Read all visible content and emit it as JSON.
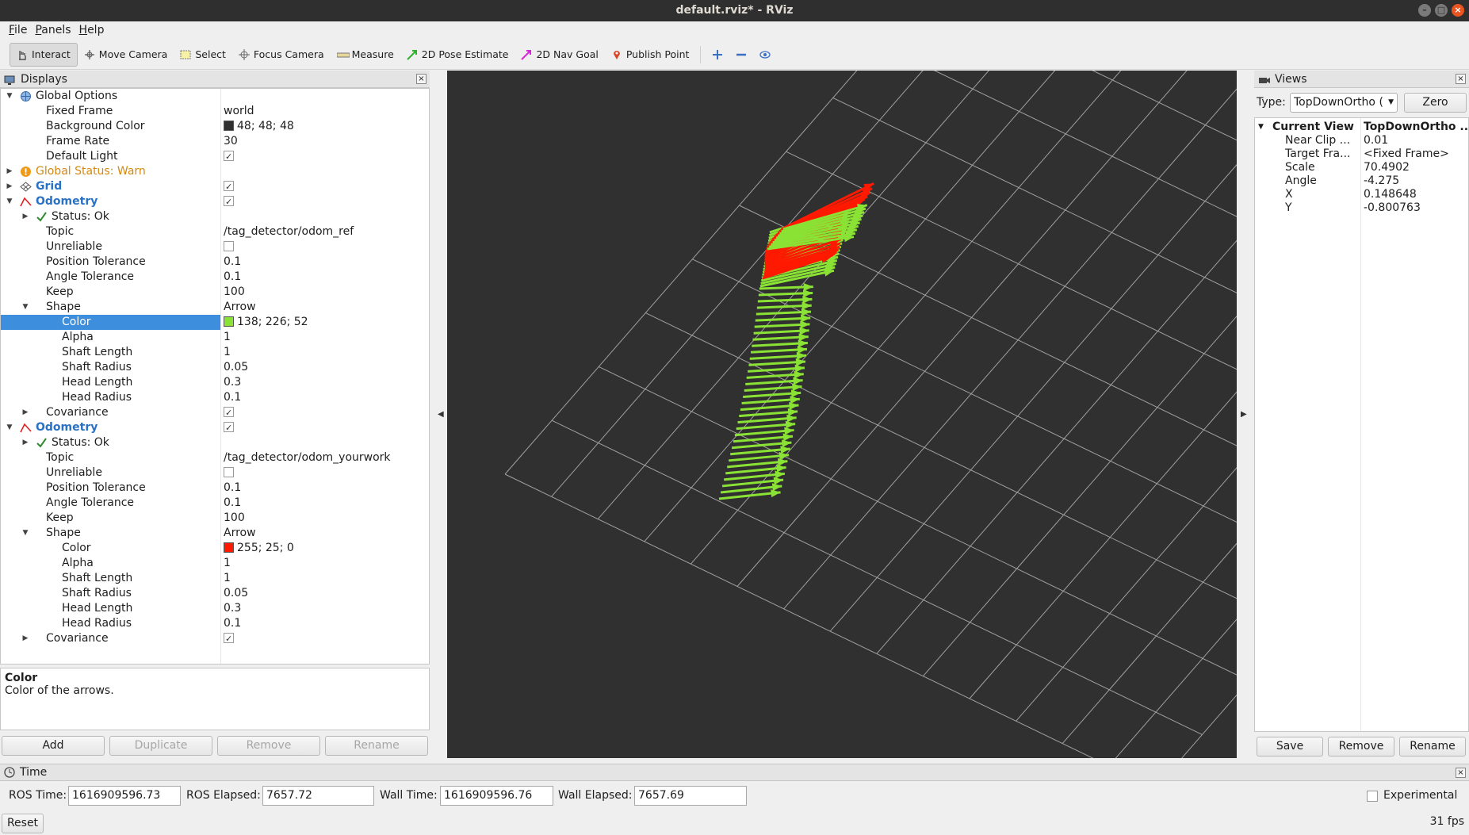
{
  "window": {
    "title": "default.rviz* - RViz"
  },
  "menu": [
    {
      "key": "F",
      "rest": "ile"
    },
    {
      "key": "P",
      "rest": "anels"
    },
    {
      "key": "H",
      "rest": "elp"
    }
  ],
  "toolbar": {
    "interact": "Interact",
    "move_camera": "Move Camera",
    "select": "Select",
    "focus_camera": "Focus Camera",
    "measure": "Measure",
    "pose_estimate": "2D Pose Estimate",
    "nav_goal": "2D Nav Goal",
    "publish_point": "Publish Point"
  },
  "displays": {
    "title": "Displays",
    "rows": [
      {
        "level": 0,
        "expander": "▼",
        "icon": "globe",
        "name": "Global Options",
        "value": "",
        "style": ""
      },
      {
        "level": 1,
        "expander": "",
        "icon": "",
        "name": "Fixed Frame",
        "value": "world",
        "style": ""
      },
      {
        "level": 1,
        "expander": "",
        "icon": "",
        "name": "Background Color",
        "value": "48; 48; 48",
        "swatch": "#303030",
        "style": ""
      },
      {
        "level": 1,
        "expander": "",
        "icon": "",
        "name": "Frame Rate",
        "value": "30",
        "style": ""
      },
      {
        "level": 1,
        "expander": "",
        "icon": "",
        "name": "Default Light",
        "check": true,
        "style": ""
      },
      {
        "level": 0,
        "expander": "▶",
        "icon": "warn",
        "name": "Global Status: Warn",
        "value": "",
        "style": "warn"
      },
      {
        "level": 0,
        "expander": "▶",
        "icon": "grid",
        "name": "Grid",
        "check": true,
        "style": "blue-bold"
      },
      {
        "level": 0,
        "expander": "▼",
        "icon": "odom",
        "name": "Odometry",
        "check": true,
        "style": "blue-bold"
      },
      {
        "level": 1,
        "expander": "▶",
        "icon": "ok",
        "name": "Status: Ok",
        "value": "",
        "style": ""
      },
      {
        "level": 1,
        "expander": "",
        "icon": "",
        "name": "Topic",
        "value": "/tag_detector/odom_ref",
        "style": ""
      },
      {
        "level": 1,
        "expander": "",
        "icon": "",
        "name": "Unreliable",
        "check": false,
        "style": ""
      },
      {
        "level": 1,
        "expander": "",
        "icon": "",
        "name": "Position Tolerance",
        "value": "0.1",
        "style": ""
      },
      {
        "level": 1,
        "expander": "",
        "icon": "",
        "name": "Angle Tolerance",
        "value": "0.1",
        "style": ""
      },
      {
        "level": 1,
        "expander": "",
        "icon": "",
        "name": "Keep",
        "value": "100",
        "style": ""
      },
      {
        "level": 1,
        "expander": "▼",
        "icon": "",
        "name": "Shape",
        "value": "Arrow",
        "style": ""
      },
      {
        "level": 2,
        "expander": "",
        "icon": "",
        "name": "Color",
        "value": "138; 226; 52",
        "swatch": "#8ae234",
        "style": "",
        "selected": true
      },
      {
        "level": 2,
        "expander": "",
        "icon": "",
        "name": "Alpha",
        "value": "1",
        "style": ""
      },
      {
        "level": 2,
        "expander": "",
        "icon": "",
        "name": "Shaft Length",
        "value": "1",
        "style": ""
      },
      {
        "level": 2,
        "expander": "",
        "icon": "",
        "name": "Shaft Radius",
        "value": "0.05",
        "style": ""
      },
      {
        "level": 2,
        "expander": "",
        "icon": "",
        "name": "Head Length",
        "value": "0.3",
        "style": ""
      },
      {
        "level": 2,
        "expander": "",
        "icon": "",
        "name": "Head Radius",
        "value": "0.1",
        "style": ""
      },
      {
        "level": 1,
        "expander": "▶",
        "icon": "",
        "name": "Covariance",
        "check": true,
        "style": ""
      },
      {
        "level": 0,
        "expander": "▼",
        "icon": "odom",
        "name": "Odometry",
        "check": true,
        "style": "blue-bold"
      },
      {
        "level": 1,
        "expander": "▶",
        "icon": "ok",
        "name": "Status: Ok",
        "value": "",
        "style": ""
      },
      {
        "level": 1,
        "expander": "",
        "icon": "",
        "name": "Topic",
        "value": "/tag_detector/odom_yourwork",
        "style": ""
      },
      {
        "level": 1,
        "expander": "",
        "icon": "",
        "name": "Unreliable",
        "check": false,
        "style": ""
      },
      {
        "level": 1,
        "expander": "",
        "icon": "",
        "name": "Position Tolerance",
        "value": "0.1",
        "style": ""
      },
      {
        "level": 1,
        "expander": "",
        "icon": "",
        "name": "Angle Tolerance",
        "value": "0.1",
        "style": ""
      },
      {
        "level": 1,
        "expander": "",
        "icon": "",
        "name": "Keep",
        "value": "100",
        "style": ""
      },
      {
        "level": 1,
        "expander": "▼",
        "icon": "",
        "name": "Shape",
        "value": "Arrow",
        "style": ""
      },
      {
        "level": 2,
        "expander": "",
        "icon": "",
        "name": "Color",
        "value": "255; 25; 0",
        "swatch": "#ff1900",
        "style": ""
      },
      {
        "level": 2,
        "expander": "",
        "icon": "",
        "name": "Alpha",
        "value": "1",
        "style": ""
      },
      {
        "level": 2,
        "expander": "",
        "icon": "",
        "name": "Shaft Length",
        "value": "1",
        "style": ""
      },
      {
        "level": 2,
        "expander": "",
        "icon": "",
        "name": "Shaft Radius",
        "value": "0.05",
        "style": ""
      },
      {
        "level": 2,
        "expander": "",
        "icon": "",
        "name": "Head Length",
        "value": "0.3",
        "style": ""
      },
      {
        "level": 2,
        "expander": "",
        "icon": "",
        "name": "Head Radius",
        "value": "0.1",
        "style": ""
      },
      {
        "level": 1,
        "expander": "▶",
        "icon": "",
        "name": "Covariance",
        "check": true,
        "style": ""
      }
    ],
    "description_title": "Color",
    "description_text": "Color of the arrows.",
    "buttons": {
      "add": "Add",
      "duplicate": "Duplicate",
      "remove": "Remove",
      "rename": "Rename"
    }
  },
  "views": {
    "title": "Views",
    "type_label": "Type:",
    "type_value": "TopDownOrtho (",
    "zero": "Zero",
    "header_name": "Current View",
    "header_value": "TopDownOrtho ...",
    "rows": [
      {
        "name": "Near Clip ...",
        "value": "0.01"
      },
      {
        "name": "Target Fra...",
        "value": "<Fixed Frame>"
      },
      {
        "name": "Scale",
        "value": "70.4902"
      },
      {
        "name": "Angle",
        "value": "-4.275"
      },
      {
        "name": "X",
        "value": "0.148648"
      },
      {
        "name": "Y",
        "value": "-0.800763"
      }
    ],
    "buttons": {
      "save": "Save",
      "remove": "Remove",
      "rename": "Rename"
    }
  },
  "time": {
    "title": "Time",
    "ros_time_label": "ROS Time:",
    "ros_time": "1616909596.73",
    "ros_elapsed_label": "ROS Elapsed:",
    "ros_elapsed": "7657.72",
    "wall_time_label": "Wall Time:",
    "wall_time": "1616909596.76",
    "wall_elapsed_label": "Wall Elapsed:",
    "wall_elapsed": "7657.69",
    "experimental": "Experimental",
    "reset": "Reset",
    "fps": "31 fps"
  },
  "scene": {
    "background": "#303030",
    "grid_color": "#a0a0a0",
    "ref_arrow_color": "#8ae234",
    "yourwork_arrow_color": "#ff1900"
  }
}
